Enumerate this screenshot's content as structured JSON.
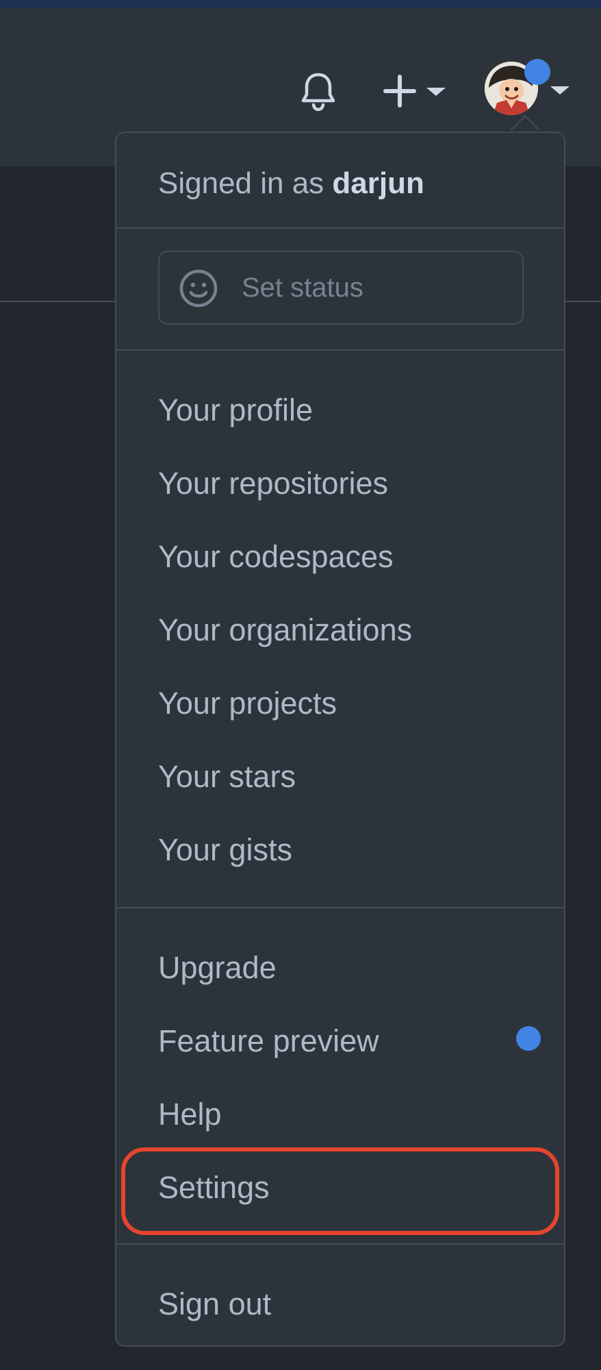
{
  "header": {
    "bell_icon": "bell-icon",
    "create_icon": "plus-icon",
    "avatar_icon": "user-avatar-icon"
  },
  "dropdown": {
    "signed_in_prefix": "Signed in as",
    "username": "darjun",
    "status_placeholder": "Set status",
    "status_icon": "smiley-icon",
    "profile_items": [
      "Your profile",
      "Your repositories",
      "Your codespaces",
      "Your organizations",
      "Your projects",
      "Your stars",
      "Your gists"
    ],
    "misc_items": {
      "upgrade": "Upgrade",
      "feature_preview": "Feature preview",
      "help": "Help",
      "settings": "Settings"
    },
    "sign_out": "Sign out"
  },
  "colors": {
    "background": "#22272e",
    "header_background": "#2d333b",
    "menu_background": "#2d333b",
    "border": "#444c56",
    "text": "#adbac7",
    "muted_text": "#768390",
    "notification_dot": "#4184e4",
    "highlight": "#e5452c"
  }
}
